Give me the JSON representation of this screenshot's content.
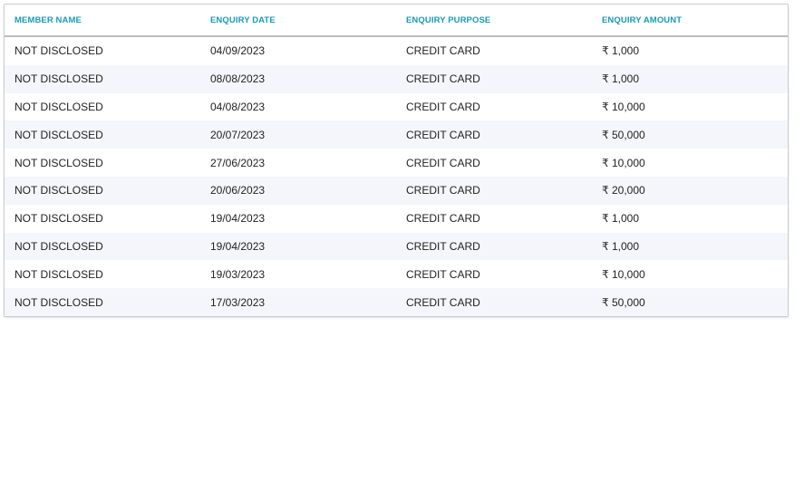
{
  "table": {
    "columns": [
      "MEMBER NAME",
      "ENQUIRY DATE",
      "ENQUIRY PURPOSE",
      "ENQUIRY AMOUNT"
    ],
    "rows": [
      [
        "NOT DISCLOSED",
        "04/09/2023",
        "CREDIT CARD",
        "₹ 1,000"
      ],
      [
        "NOT DISCLOSED",
        "08/08/2023",
        "CREDIT CARD",
        "₹ 1,000"
      ],
      [
        "NOT DISCLOSED",
        "04/08/2023",
        "CREDIT CARD",
        "₹ 10,000"
      ],
      [
        "NOT DISCLOSED",
        "20/07/2023",
        "CREDIT CARD",
        "₹ 50,000"
      ],
      [
        "NOT DISCLOSED",
        "27/06/2023",
        "CREDIT CARD",
        "₹ 10,000"
      ],
      [
        "NOT DISCLOSED",
        "20/06/2023",
        "CREDIT CARD",
        "₹ 20,000"
      ],
      [
        "NOT DISCLOSED",
        "19/04/2023",
        "CREDIT CARD",
        "₹ 1,000"
      ],
      [
        "NOT DISCLOSED",
        "19/04/2023",
        "CREDIT CARD",
        "₹ 1,000"
      ],
      [
        "NOT DISCLOSED",
        "19/03/2023",
        "CREDIT CARD",
        "₹ 10,000"
      ],
      [
        "NOT DISCLOSED",
        "17/03/2023",
        "CREDIT CARD",
        "₹ 50,000"
      ]
    ]
  },
  "colors": {
    "header_text": "#1a9bb5",
    "row_stripe": "#f4f6fb",
    "body_text": "#222222"
  }
}
